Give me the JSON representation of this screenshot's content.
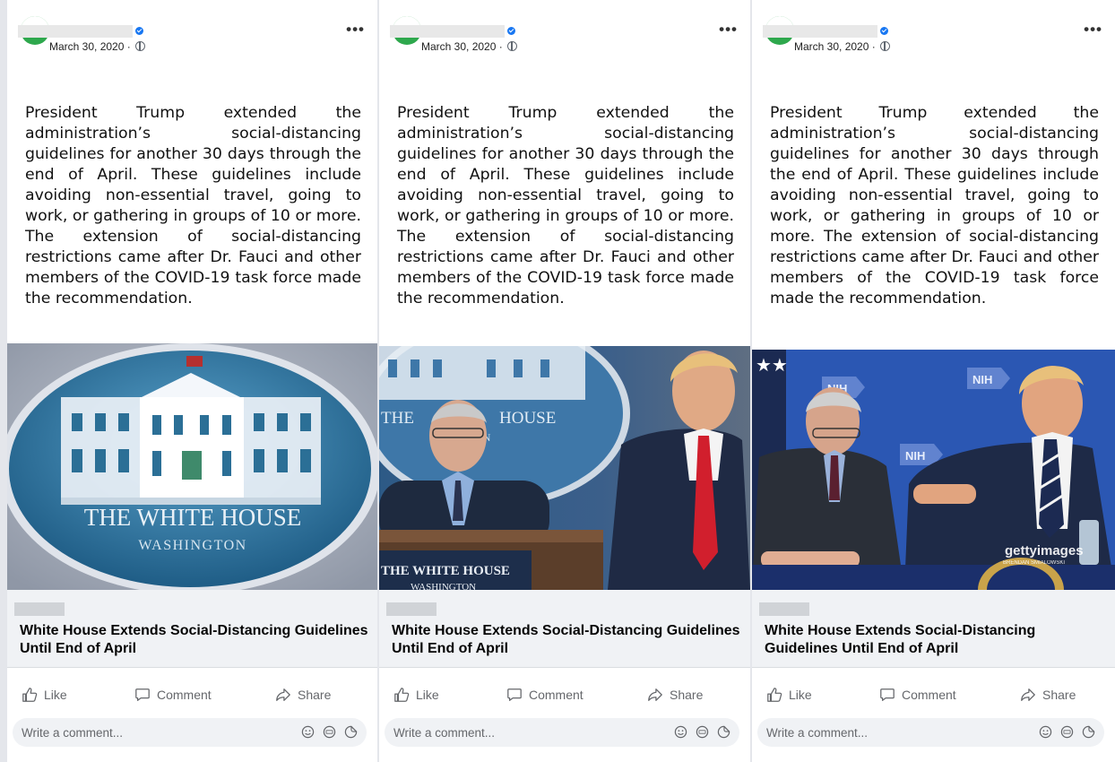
{
  "posts": [
    {
      "date": "March 30, 2020 ·",
      "text": "President Trump extended the administration’s social-distancing guidelines for another 30 days through the end of April. These guidelines include avoiding non-essential travel, going to work, or gathering in groups of 10 or more. The extension of social-distancing restrictions came after Dr. Fauci and other members of the COVID-19 task force made the recommendation.",
      "image_text": [
        "THE WHITE HOUSE",
        "WASHINGTON"
      ],
      "headline": "White House Extends Social-Distancing Guidelines Until End of April"
    },
    {
      "date": "March 30, 2020 ·",
      "text": "President Trump extended the administration’s social-distancing guidelines for another 30 days through the end of April. These guidelines include avoiding non-essential travel, going to work, or gathering in groups of 10 or more. The extension of social-distancing restrictions came after Dr. Fauci and other members of the COVID-19 task force made the recommendation.",
      "image_text": [
        "THE",
        "HOUSE",
        "TON",
        "THE WHITE HOUSE",
        "WASHINGTON"
      ],
      "headline": "White House Extends Social-Distancing Guidelines Until End of April"
    },
    {
      "date": "March 30, 2020 ·",
      "text": "President Trump extended the administration’s social-distancing guidelines for another 30 days through the end of April. These guidelines include avoiding non-essential travel, going to work, or gathering in groups of 10 or more. The extension of social-distancing restrictions came after Dr. Fauci and other members of the COVID-19 task force made the recommendation.",
      "image_text": [
        "NIH",
        "NIH",
        "NIH",
        "gettyimages",
        "BRENDAN SMIALOWSKI"
      ],
      "headline": "White House Extends Social-Distancing Guidelines Until End of April"
    }
  ],
  "actions": {
    "like": "Like",
    "comment": "Comment",
    "share": "Share"
  },
  "comment_placeholder": "Write a comment...",
  "more_label": "•••",
  "icons": {
    "verified": "verified-badge-icon",
    "privacy": "globe-icon",
    "like": "thumbs-up-icon",
    "comment": "speech-bubble-icon",
    "share": "share-arrow-icon",
    "emoji": "smiley-icon",
    "gif": "gif-icon",
    "sticker": "sticker-icon"
  },
  "colors": {
    "accent": "#1877f2",
    "avatar": "#2ea84d",
    "link_card": "#f0f2f5",
    "muted_text": "#65676b"
  }
}
